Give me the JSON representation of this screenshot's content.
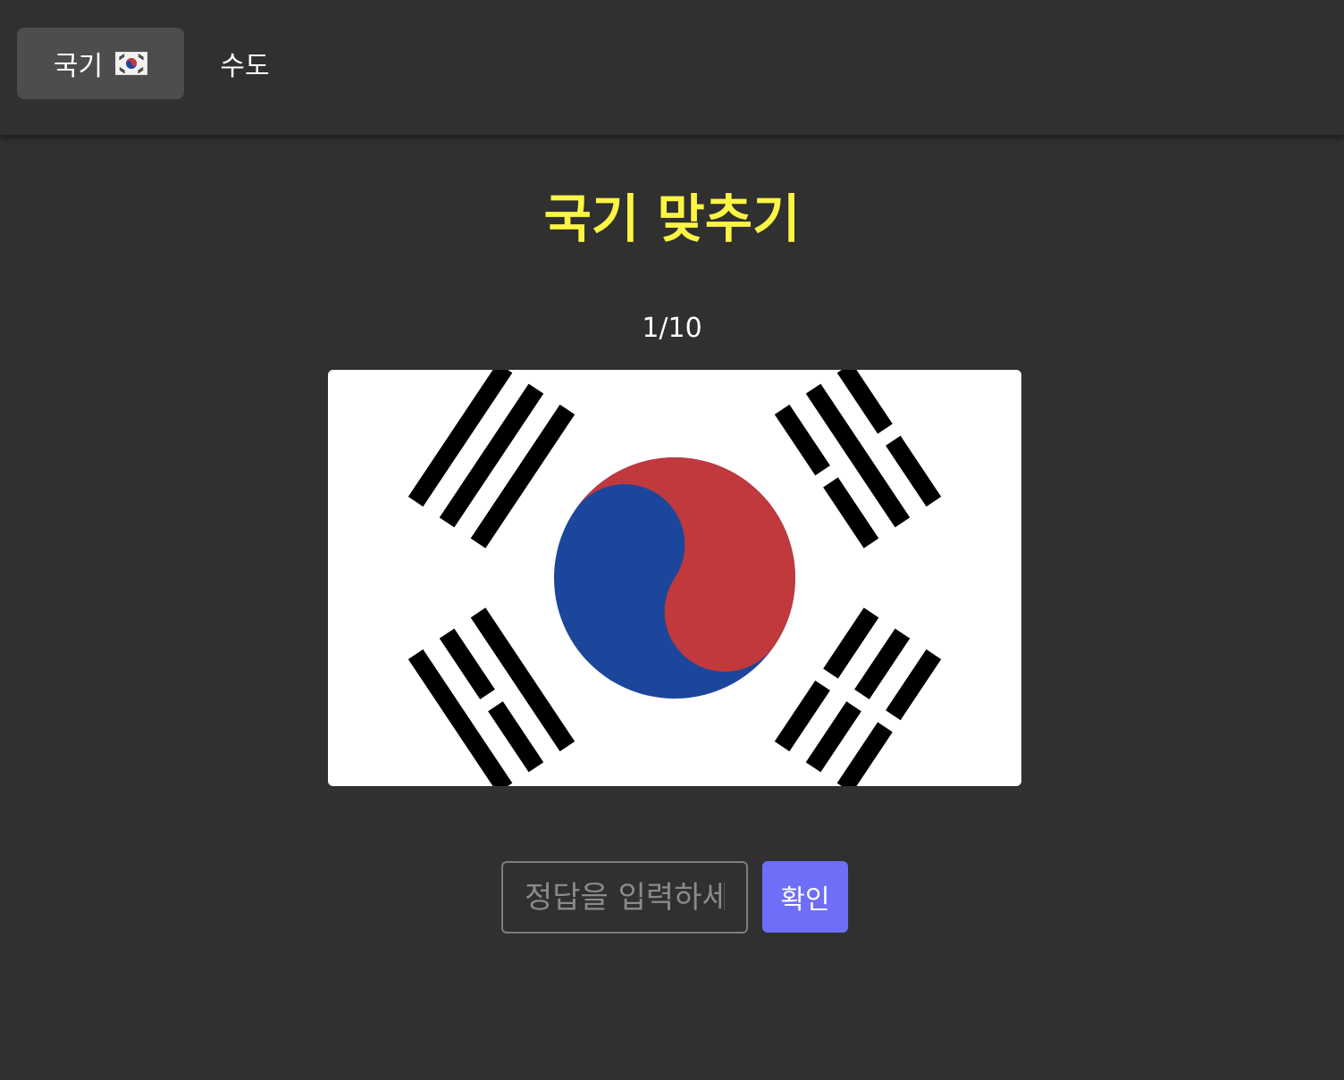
{
  "nav": {
    "tabs": [
      {
        "label": "국기",
        "icon": "south-korea-flag-icon",
        "active": true
      },
      {
        "label": "수도",
        "active": false
      }
    ]
  },
  "quiz": {
    "title": "국기 맞추기",
    "progress": "1/10",
    "flag_icon": "south-korea-flag-icon",
    "answer_placeholder": "정답을 입력하세요",
    "answer_value": "",
    "submit_label": "확인"
  },
  "colors": {
    "background": "#303030",
    "title": "#fdf544",
    "active_tab": "#4d4d4d",
    "submit_button": "#6e6ef8",
    "flag_red": "#c0393d",
    "flag_blue": "#1b469c"
  }
}
